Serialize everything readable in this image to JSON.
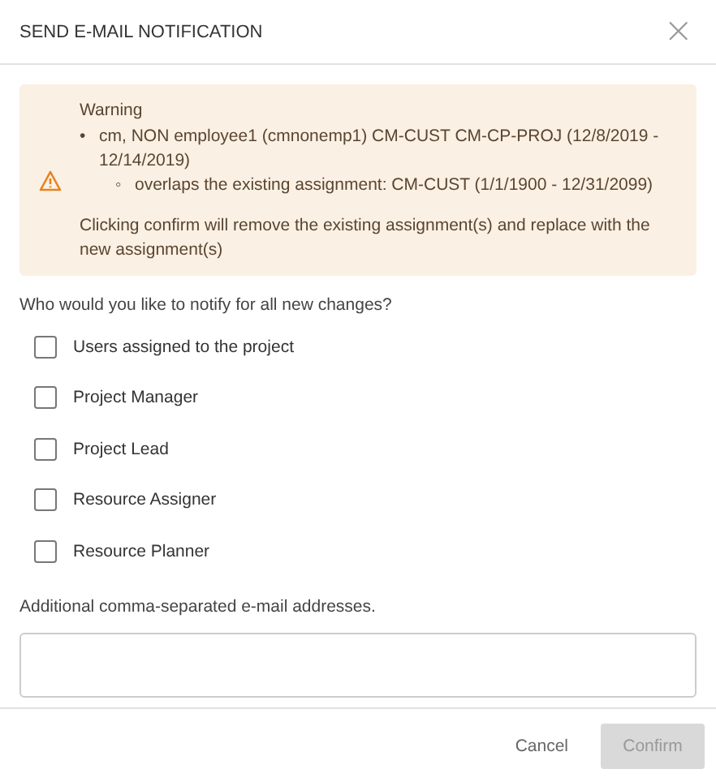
{
  "dialog": {
    "title": "SEND E-MAIL NOTIFICATION",
    "close": "×"
  },
  "warning": {
    "heading": "Warning",
    "items": [
      {
        "marker": "•",
        "text": "cm, NON employee1 (cmnonemp1) CM-CUST CM-CP-PROJ (12/8/2019 - 12/14/2019)",
        "children": [
          {
            "marker": "◦",
            "text": "overlaps the existing assignment: CM-CUST (1/1/1900 - 12/31/2099)"
          }
        ]
      }
    ],
    "note": "Clicking confirm will remove the existing assignment(s) and replace with the new assignment(s)"
  },
  "question": "Who would you like to notify for all new changes?",
  "options": [
    {
      "label": "Users assigned to the project",
      "checked": false
    },
    {
      "label": "Project Manager",
      "checked": false
    },
    {
      "label": "Project Lead",
      "checked": false
    },
    {
      "label": "Resource Assigner",
      "checked": false
    },
    {
      "label": "Resource Planner",
      "checked": false
    }
  ],
  "email_field": {
    "label": "Additional comma-separated e-mail addresses."
  },
  "buttons": [
    {
      "label": "Cancel",
      "kind": "text",
      "disabled": false
    },
    {
      "label": "Confirm",
      "kind": "primary",
      "disabled": true
    }
  ]
}
